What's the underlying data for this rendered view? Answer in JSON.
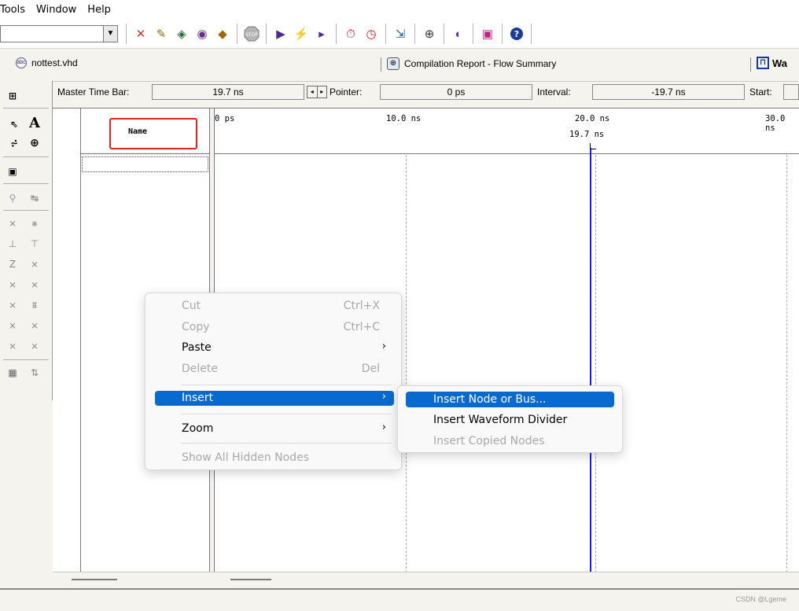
{
  "menubar": {
    "items": [
      "Tools",
      "Window",
      "Help"
    ]
  },
  "toolbar": {
    "combo_value": "",
    "icons": [
      "compile-icon",
      "pen-icon",
      "analysis-icon",
      "synthesis-icon",
      "fitter-icon",
      "stop-icon",
      "start-icon",
      "timing-analyzer-icon",
      "simulator-icon",
      "timer-icon",
      "clock-icon",
      "rtl-viewer-icon",
      "report-icon",
      "chip-planner-icon",
      "programmer-icon",
      "help-icon"
    ]
  },
  "tabs": {
    "file": "nottest.vhd",
    "report": "Compilation Report - Flow Summary",
    "wave": "Wa",
    "file_icon_text": "abc"
  },
  "timebar": {
    "master_label": "Master Time Bar:",
    "master_value": "19.7 ns",
    "pointer_label": "Pointer:",
    "pointer_value": "0 ps",
    "interval_label": "Interval:",
    "interval_value": "-19.7 ns",
    "start_label": "Start:"
  },
  "editor": {
    "name_header": "Name",
    "ruler": [
      "0 ps",
      "10.0 ns",
      "20.0 ns",
      "30.0 ns"
    ],
    "master_marker": "19.7 ns"
  },
  "context_menu": {
    "items": [
      {
        "label": "Cut",
        "shortcut": "Ctrl+X",
        "state": "disabled"
      },
      {
        "label": "Copy",
        "shortcut": "Ctrl+C",
        "state": "disabled"
      },
      {
        "label": "Paste",
        "submenu": true,
        "state": "enabled"
      },
      {
        "label": "Delete",
        "shortcut": "Del",
        "state": "disabled"
      },
      {
        "label": "Insert",
        "submenu": true,
        "state": "active"
      },
      {
        "label": "Zoom",
        "submenu": true,
        "state": "enabled"
      },
      {
        "label": "Show All Hidden Nodes",
        "state": "disabled"
      }
    ]
  },
  "submenu": {
    "items": [
      {
        "label": "Insert Node or Bus...",
        "state": "active"
      },
      {
        "label": "Insert Waveform Divider",
        "state": "enabled"
      },
      {
        "label": "Insert Copied Nodes",
        "state": "disabled"
      }
    ]
  },
  "watermark": "CSDN @Lgeme",
  "colors": {
    "highlight": "#0869cf",
    "annotation": "#e0251f",
    "master_line": "#1d1dcf"
  }
}
